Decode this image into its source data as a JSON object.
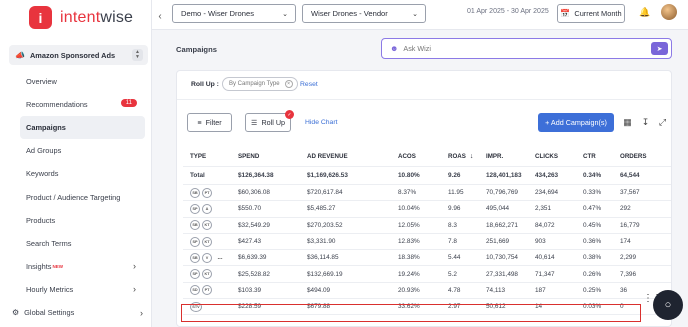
{
  "brand": {
    "mark": "i",
    "name_part1": "intent",
    "name_part2": "wise"
  },
  "sidebar": {
    "section_title": "Amazon Sponsored Ads",
    "items": [
      {
        "label": "Overview"
      },
      {
        "label": "Recommendations",
        "badge": "11"
      },
      {
        "label": "Campaigns",
        "active": true
      },
      {
        "label": "Ad Groups"
      },
      {
        "label": "Keywords"
      },
      {
        "label": "Product / Audience Targeting"
      },
      {
        "label": "Products"
      },
      {
        "label": "Search Terms"
      },
      {
        "label": "Insights",
        "tag": "NEW"
      },
      {
        "label": "Hourly Metrics"
      }
    ],
    "footer_label": "Global Settings"
  },
  "topbar": {
    "account_select": "Demo - Wiser Drones",
    "profile_select": "Wiser Drones - Vendor",
    "date_range": "01 Apr 2025 - 30 Apr 2025",
    "period_button": "Current Month"
  },
  "main": {
    "title": "Campaigns",
    "wizi_placeholder": "Ask Wizi"
  },
  "panel": {
    "rollup_label": "Roll Up :",
    "rollup_chip": "By Campaign Type",
    "reset_label": "Reset",
    "filter_label": "Filter",
    "rollup_button": "Roll Up",
    "hide_chart": "Hide Chart",
    "add_campaign": "+ Add Campaign(s)"
  },
  "table": {
    "headers": [
      "TYPE",
      "SPEND",
      "AD REVENUE",
      "ACOS",
      "ROAS",
      "IMPR.",
      "CLICKS",
      "CTR",
      "ORDERS"
    ],
    "total": {
      "type": "Total",
      "spend": "$126,364.38",
      "revenue": "$1,169,626.53",
      "acos": "10.80%",
      "roas": "9.26",
      "impr": "128,401,183",
      "clicks": "434,263",
      "ctr": "0.34%",
      "orders": "64,544"
    },
    "rows": [
      {
        "badges": [
          "SB",
          "PT"
        ],
        "spend": "$60,306.08",
        "revenue": "$720,617.84",
        "acos": "8.37%",
        "roas": "11.95",
        "impr": "70,796,769",
        "clicks": "234,694",
        "ctr": "0.33%",
        "orders": "37,567"
      },
      {
        "badges": [
          "SP",
          "A"
        ],
        "spend": "$550.70",
        "revenue": "$5,485.27",
        "acos": "10.04%",
        "roas": "9.96",
        "impr": "495,044",
        "clicks": "2,351",
        "ctr": "0.47%",
        "orders": "292"
      },
      {
        "badges": [
          "SB",
          "KT"
        ],
        "spend": "$32,549.29",
        "revenue": "$270,203.52",
        "acos": "12.05%",
        "roas": "8.3",
        "impr": "18,662,271",
        "clicks": "84,072",
        "ctr": "0.45%",
        "orders": "16,779"
      },
      {
        "badges": [
          "SP",
          "KT"
        ],
        "spend": "$427.43",
        "revenue": "$3,331.90",
        "acos": "12.83%",
        "roas": "7.8",
        "impr": "251,669",
        "clicks": "903",
        "ctr": "0.36%",
        "orders": "174"
      },
      {
        "badges": [
          "SB",
          "V",
          "..."
        ],
        "spend": "$6,639.39",
        "revenue": "$36,114.85",
        "acos": "18.38%",
        "roas": "5.44",
        "impr": "10,730,754",
        "clicks": "40,614",
        "ctr": "0.38%",
        "orders": "2,299"
      },
      {
        "badges": [
          "SP",
          "KT"
        ],
        "spend": "$25,528.82",
        "revenue": "$132,669.19",
        "acos": "19.24%",
        "roas": "5.2",
        "impr": "27,331,498",
        "clicks": "71,347",
        "ctr": "0.26%",
        "orders": "7,396"
      },
      {
        "badges": [
          "SD",
          "PT"
        ],
        "spend": "$103.39",
        "revenue": "$494.09",
        "acos": "20.93%",
        "roas": "4.78",
        "impr": "74,113",
        "clicks": "187",
        "ctr": "0.25%",
        "orders": "36"
      },
      {
        "badges": [
          "STV"
        ],
        "spend": "$228.59",
        "revenue": "$679.88",
        "acos": "33.62%",
        "roas": "2.97",
        "impr": "50,612",
        "clicks": "14",
        "ctr": "0.03%",
        "orders": "0"
      }
    ]
  },
  "colors": {
    "brand_red": "#e8343e",
    "primary_blue": "#3d6fd8",
    "wizi_purple": "#7a66d9",
    "highlight_red": "#d9302e"
  }
}
